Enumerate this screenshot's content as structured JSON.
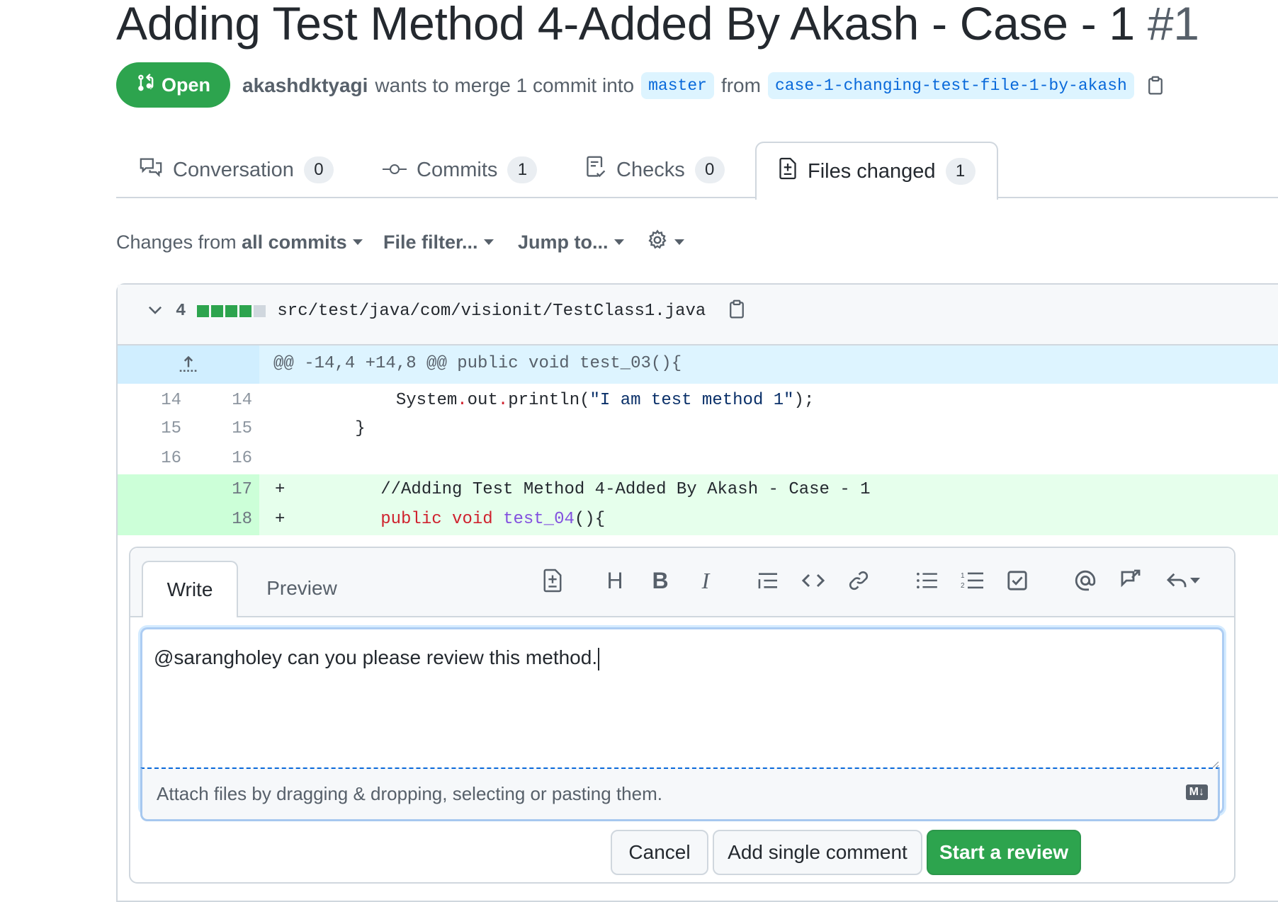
{
  "pr": {
    "title": "Adding Test Method 4-Added By Akash - Case - 1",
    "number": "#1",
    "state": "Open",
    "author": "akashdktyagi",
    "merge_text": "wants to merge 1 commit into",
    "base_branch": "master",
    "from_text": "from",
    "head_branch": "case-1-changing-test-file-1-by-akash"
  },
  "tabs": [
    {
      "label": "Conversation",
      "count": "0"
    },
    {
      "label": "Commits",
      "count": "1"
    },
    {
      "label": "Checks",
      "count": "0"
    },
    {
      "label": "Files changed",
      "count": "1"
    }
  ],
  "filters": {
    "changes_prefix": "Changes from",
    "changes_value": "all commits",
    "file_filter": "File filter...",
    "jump_to": "Jump to..."
  },
  "file": {
    "changes": "4",
    "path": "src/test/java/com/visionit/TestClass1.java",
    "hunk": "@@ -14,4 +14,8 @@ public void test_03(){",
    "colors": {
      "add": "#2da44e",
      "neutral": "#d0d7de"
    },
    "lines": [
      {
        "old": "14",
        "new": "14",
        "marker": "",
        "code": ""
      },
      {
        "old": "15",
        "new": "15",
        "marker": "",
        "code": "        }"
      },
      {
        "old": "16",
        "new": "16",
        "marker": "",
        "code": ""
      },
      {
        "old": "",
        "new": "17",
        "marker": "+",
        "code": "        //Adding Test Method 4-Added By Akash - Case - 1"
      },
      {
        "old": "",
        "new": "18",
        "marker": "+",
        "code": ""
      }
    ],
    "line14": {
      "indent": "            ",
      "obj": "System",
      "dot1": ".",
      "field": "out",
      "dot2": ".",
      "method": "println(",
      "string": "\"I am test method 1\"",
      "end": ");"
    },
    "line18": {
      "indent": "        ",
      "kw": "public void",
      "name": "test_04",
      "end": "(){"
    }
  },
  "comment": {
    "tab_write": "Write",
    "tab_preview": "Preview",
    "text": "@sarangholey can you please review this method.",
    "attach_text": "Attach files by dragging & dropping, selecting or pasting them.",
    "markdown_badge": "M↓",
    "cancel": "Cancel",
    "add_single": "Add single comment",
    "start_review": "Start a review"
  },
  "toolbar": [
    "heading-add-icon",
    "heading-icon",
    "bold-icon",
    "italic-icon",
    "quote-icon",
    "code-icon",
    "link-icon",
    "bulleted-list-icon",
    "numbered-list-icon",
    "task-list-icon",
    "mention-icon",
    "cross-reference-icon",
    "reply-icon"
  ]
}
